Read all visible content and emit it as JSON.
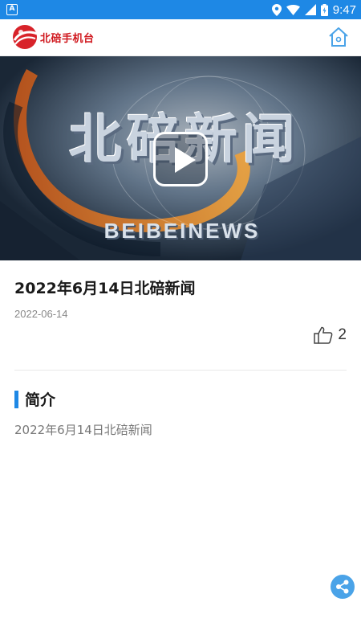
{
  "status_bar": {
    "notification_icon": "A",
    "time": "9:47",
    "icons": [
      "location-icon",
      "wifi-icon",
      "signal-icon",
      "battery-icon"
    ]
  },
  "app_bar": {
    "brand_name": "北碚手机台",
    "brand_color": "#d0181e",
    "home_icon": "home-icon"
  },
  "video": {
    "overlay_title": "北碚新闻",
    "overlay_subtitle": "BEIBEINEWS",
    "play_icon": "play-icon"
  },
  "article": {
    "title": "2022年6月14日北碚新闻",
    "date": "2022-06-14",
    "like_count": "2",
    "section_title": "简介",
    "description": "2022年6月14日北碚新闻"
  },
  "colors": {
    "accent": "#1e88e5",
    "share_fab": "#4aa3e8"
  },
  "share_icon": "share-icon"
}
